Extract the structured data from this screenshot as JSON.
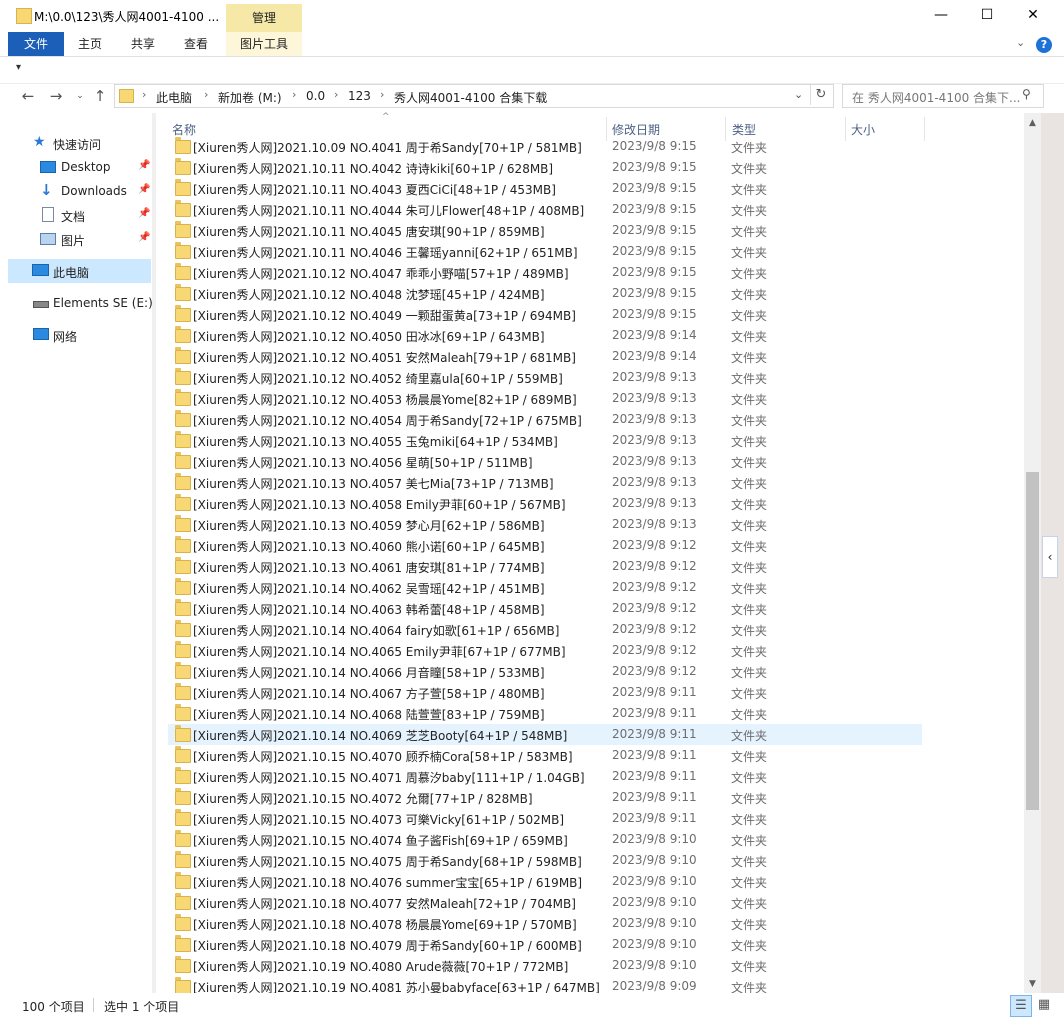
{
  "window": {
    "title": "M:\\0.0\\123\\秀人网4001-4100 ...",
    "context_tab": "管理",
    "minimize": "—",
    "maximize": "☐",
    "close": "✕"
  },
  "ribbon": {
    "tabs": [
      "文件",
      "主页",
      "共享",
      "查看",
      "图片工具"
    ],
    "help": "?"
  },
  "address": {
    "crumbs": [
      "此电脑",
      "新加卷 (M:)",
      "0.0",
      "123",
      "秀人网4001-4100 合集下载"
    ],
    "search_placeholder": "在 秀人网4001-4100 合集下..."
  },
  "sidebar": {
    "quick_access": "快速访问",
    "pinned": [
      "Desktop",
      "Downloads",
      "文档",
      "图片"
    ],
    "this_pc": "此电脑",
    "drive": "Elements SE (E:)",
    "network": "网络"
  },
  "columns": {
    "name": "名称",
    "date": "修改日期",
    "type": "类型",
    "size": "大小"
  },
  "files": [
    {
      "name": "[Xiuren秀人网]2021.10.09 NO.4041 周于希Sandy[70+1P / 581MB]",
      "date": "2023/9/8 9:15",
      "type": "文件夹"
    },
    {
      "name": "[Xiuren秀人网]2021.10.11 NO.4042 诗诗kiki[60+1P / 628MB]",
      "date": "2023/9/8 9:15",
      "type": "文件夹"
    },
    {
      "name": "[Xiuren秀人网]2021.10.11 NO.4043 夏西CiCi[48+1P / 453MB]",
      "date": "2023/9/8 9:15",
      "type": "文件夹"
    },
    {
      "name": "[Xiuren秀人网]2021.10.11 NO.4044 朱可儿Flower[48+1P / 408MB]",
      "date": "2023/9/8 9:15",
      "type": "文件夹"
    },
    {
      "name": "[Xiuren秀人网]2021.10.11 NO.4045 唐安琪[90+1P / 859MB]",
      "date": "2023/9/8 9:15",
      "type": "文件夹"
    },
    {
      "name": "[Xiuren秀人网]2021.10.11 NO.4046 王馨瑶yanni[62+1P / 651MB]",
      "date": "2023/9/8 9:15",
      "type": "文件夹"
    },
    {
      "name": "[Xiuren秀人网]2021.10.12 NO.4047 乖乖小野喵[57+1P / 489MB]",
      "date": "2023/9/8 9:15",
      "type": "文件夹"
    },
    {
      "name": "[Xiuren秀人网]2021.10.12 NO.4048 沈梦瑶[45+1P / 424MB]",
      "date": "2023/9/8 9:15",
      "type": "文件夹"
    },
    {
      "name": "[Xiuren秀人网]2021.10.12 NO.4049 一颗甜蛋黄a[73+1P / 694MB]",
      "date": "2023/9/8 9:15",
      "type": "文件夹"
    },
    {
      "name": "[Xiuren秀人网]2021.10.12 NO.4050 田冰冰[69+1P / 643MB]",
      "date": "2023/9/8 9:14",
      "type": "文件夹"
    },
    {
      "name": "[Xiuren秀人网]2021.10.12 NO.4051 安然Maleah[79+1P / 681MB]",
      "date": "2023/9/8 9:14",
      "type": "文件夹"
    },
    {
      "name": "[Xiuren秀人网]2021.10.12 NO.4052 绮里嘉ula[60+1P / 559MB]",
      "date": "2023/9/8 9:13",
      "type": "文件夹"
    },
    {
      "name": "[Xiuren秀人网]2021.10.12 NO.4053 杨晨晨Yome[82+1P / 689MB]",
      "date": "2023/9/8 9:13",
      "type": "文件夹"
    },
    {
      "name": "[Xiuren秀人网]2021.10.12 NO.4054 周于希Sandy[72+1P / 675MB]",
      "date": "2023/9/8 9:13",
      "type": "文件夹"
    },
    {
      "name": "[Xiuren秀人网]2021.10.13 NO.4055 玉兔miki[64+1P / 534MB]",
      "date": "2023/9/8 9:13",
      "type": "文件夹"
    },
    {
      "name": "[Xiuren秀人网]2021.10.13 NO.4056 星萌[50+1P / 511MB]",
      "date": "2023/9/8 9:13",
      "type": "文件夹"
    },
    {
      "name": "[Xiuren秀人网]2021.10.13 NO.4057 美七Mia[73+1P / 713MB]",
      "date": "2023/9/8 9:13",
      "type": "文件夹"
    },
    {
      "name": "[Xiuren秀人网]2021.10.13 NO.4058 Emily尹菲[60+1P / 567MB]",
      "date": "2023/9/8 9:13",
      "type": "文件夹"
    },
    {
      "name": "[Xiuren秀人网]2021.10.13 NO.4059 梦心月[62+1P / 586MB]",
      "date": "2023/9/8 9:13",
      "type": "文件夹"
    },
    {
      "name": "[Xiuren秀人网]2021.10.13 NO.4060 熊小诺[60+1P / 645MB]",
      "date": "2023/9/8 9:12",
      "type": "文件夹"
    },
    {
      "name": "[Xiuren秀人网]2021.10.13 NO.4061 唐安琪[81+1P / 774MB]",
      "date": "2023/9/8 9:12",
      "type": "文件夹"
    },
    {
      "name": "[Xiuren秀人网]2021.10.14 NO.4062 吴雪瑶[42+1P / 451MB]",
      "date": "2023/9/8 9:12",
      "type": "文件夹"
    },
    {
      "name": "[Xiuren秀人网]2021.10.14 NO.4063 韩希蕾[48+1P / 458MB]",
      "date": "2023/9/8 9:12",
      "type": "文件夹"
    },
    {
      "name": "[Xiuren秀人网]2021.10.14 NO.4064 fairy如歌[61+1P / 656MB]",
      "date": "2023/9/8 9:12",
      "type": "文件夹"
    },
    {
      "name": "[Xiuren秀人网]2021.10.14 NO.4065 Emily尹菲[67+1P / 677MB]",
      "date": "2023/9/8 9:12",
      "type": "文件夹"
    },
    {
      "name": "[Xiuren秀人网]2021.10.14 NO.4066 月音瞳[58+1P / 533MB]",
      "date": "2023/9/8 9:12",
      "type": "文件夹"
    },
    {
      "name": "[Xiuren秀人网]2021.10.14 NO.4067 方子萱[58+1P / 480MB]",
      "date": "2023/9/8 9:11",
      "type": "文件夹"
    },
    {
      "name": "[Xiuren秀人网]2021.10.14 NO.4068 陆萱萱[83+1P / 759MB]",
      "date": "2023/9/8 9:11",
      "type": "文件夹"
    },
    {
      "name": "[Xiuren秀人网]2021.10.14 NO.4069 芝芝Booty[64+1P / 548MB]",
      "date": "2023/9/8 9:11",
      "type": "文件夹"
    },
    {
      "name": "[Xiuren秀人网]2021.10.15 NO.4070 顾乔楠Cora[58+1P / 583MB]",
      "date": "2023/9/8 9:11",
      "type": "文件夹"
    },
    {
      "name": "[Xiuren秀人网]2021.10.15 NO.4071 周慕汐baby[111+1P / 1.04GB]",
      "date": "2023/9/8 9:11",
      "type": "文件夹"
    },
    {
      "name": "[Xiuren秀人网]2021.10.15 NO.4072 允爾[77+1P / 828MB]",
      "date": "2023/9/8 9:11",
      "type": "文件夹"
    },
    {
      "name": "[Xiuren秀人网]2021.10.15 NO.4073 可樂Vicky[61+1P / 502MB]",
      "date": "2023/9/8 9:11",
      "type": "文件夹"
    },
    {
      "name": "[Xiuren秀人网]2021.10.15 NO.4074 鱼子酱Fish[69+1P / 659MB]",
      "date": "2023/9/8 9:10",
      "type": "文件夹"
    },
    {
      "name": "[Xiuren秀人网]2021.10.15 NO.4075 周于希Sandy[68+1P / 598MB]",
      "date": "2023/9/8 9:10",
      "type": "文件夹"
    },
    {
      "name": "[Xiuren秀人网]2021.10.18 NO.4076 summer宝宝[65+1P / 619MB]",
      "date": "2023/9/8 9:10",
      "type": "文件夹"
    },
    {
      "name": "[Xiuren秀人网]2021.10.18 NO.4077 安然Maleah[72+1P / 704MB]",
      "date": "2023/9/8 9:10",
      "type": "文件夹"
    },
    {
      "name": "[Xiuren秀人网]2021.10.18 NO.4078 杨晨晨Yome[69+1P / 570MB]",
      "date": "2023/9/8 9:10",
      "type": "文件夹"
    },
    {
      "name": "[Xiuren秀人网]2021.10.18 NO.4079 周于希Sandy[60+1P / 600MB]",
      "date": "2023/9/8 9:10",
      "type": "文件夹"
    },
    {
      "name": "[Xiuren秀人网]2021.10.19 NO.4080 Arude薇薇[70+1P / 772MB]",
      "date": "2023/9/8 9:10",
      "type": "文件夹"
    },
    {
      "name": "[Xiuren秀人网]2021.10.19 NO.4081 苏小曼babyface[63+1P / 647MB]",
      "date": "2023/9/8 9:09",
      "type": "文件夹"
    }
  ],
  "selected_index": 28,
  "status": {
    "count": "100 个项目",
    "selection": "选中 1 个项目"
  },
  "colors": {
    "accent": "#1c5fb8",
    "selection": "#e5f3ff",
    "folder": "#f8d775",
    "manage_tab": "#f6e9a8"
  }
}
